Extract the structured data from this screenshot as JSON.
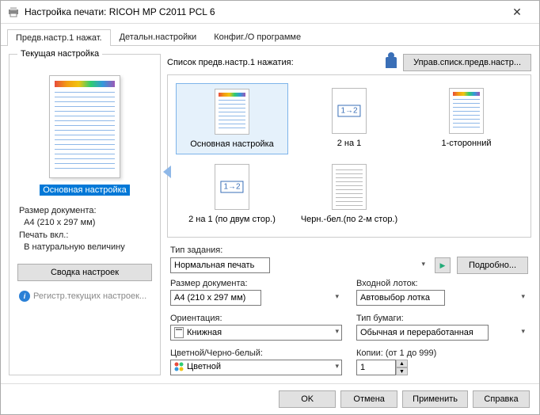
{
  "window": {
    "title": "Настройка печати: RICOH MP C2011 PCL 6"
  },
  "tabs": [
    {
      "label": "Предв.настр.1 нажат."
    },
    {
      "label": "Детальн.настройки"
    },
    {
      "label": "Конфиг./О программе"
    }
  ],
  "left": {
    "group_title": "Текущая настройка",
    "preset_name": "Основная настройка",
    "doc_size_label": "Размер документа:",
    "doc_size_value": "A4 (210 x 297 мм)",
    "print_on_label": "Печать вкл.:",
    "print_on_value": "В натуральную величину",
    "summary_btn": "Сводка настроек",
    "register_link": "Регистр.текущих настроек..."
  },
  "right": {
    "list_label": "Список предв.настр.1 нажатия:",
    "manage_btn": "Управ.списк.предв.настр...",
    "presets": [
      {
        "label": "Основная настройка"
      },
      {
        "label": "2 на 1"
      },
      {
        "label": "1-сторонний"
      },
      {
        "label": "2 на 1 (по двум стор.)"
      },
      {
        "label": "Черн.-бел.(по 2-м стор.)"
      }
    ],
    "job_type_label": "Тип задания:",
    "job_type_value": "Нормальная печать",
    "details_btn": "Подробно...",
    "doc_size_label": "Размер документа:",
    "doc_size_value": "A4 (210 x 297 мм)",
    "tray_label": "Входной лоток:",
    "tray_value": "Автовыбор лотка",
    "orient_label": "Ориентация:",
    "orient_value": "Книжная",
    "paper_type_label": "Тип бумаги:",
    "paper_type_value": "Обычная и переработанная",
    "color_label": "Цветной/Черно-белый:",
    "color_value": "Цветной",
    "copies_label": "Копии: (от 1 до 999)",
    "copies_value": "1"
  },
  "buttons": {
    "ok": "OK",
    "cancel": "Отмена",
    "apply": "Применить",
    "help": "Справка"
  }
}
